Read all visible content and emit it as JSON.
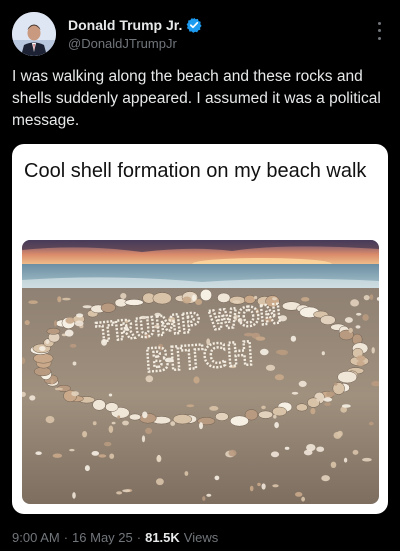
{
  "author": {
    "display_name": "Donald Trump Jr.",
    "handle": "@DonaldJTrumpJr",
    "verified_color": "#1d9bf0"
  },
  "tweet": {
    "text": "I was walking along the beach and these rocks and shells suddenly appeared. I assumed it was a political message."
  },
  "card": {
    "caption": "Cool shell formation on my beach walk",
    "photo": {
      "line1": "TRUMP WON",
      "line2": "BITCH"
    }
  },
  "meta": {
    "time": "9:00 AM",
    "date": "16 May 25",
    "views_count": "81.5K",
    "views_label": "Views",
    "separator": "·"
  },
  "icons": {
    "more": "more-options-icon",
    "verified": "verified-badge-icon"
  },
  "colors": {
    "background": "#000000",
    "text": "#e7e9ea",
    "muted": "#71767b",
    "accent": "#1d9bf0"
  }
}
